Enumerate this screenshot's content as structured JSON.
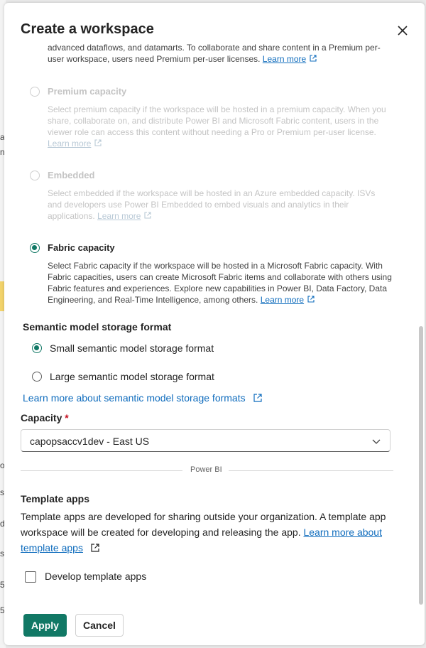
{
  "background": {
    "fragments": [
      "a",
      "n",
      "o",
      "s",
      "d",
      "s",
      "5",
      "5"
    ]
  },
  "dialog": {
    "title": "Create a workspace",
    "close_label": "Close"
  },
  "intro": {
    "line1": "advanced dataflows, and datamarts. To collaborate and share content in a Premium per-",
    "line2": "user workspace, users need Premium per-user licenses. ",
    "link": "Learn more"
  },
  "license_options": [
    {
      "label": "Premium capacity",
      "state": "disabled",
      "lines": [
        "Select premium capacity if the workspace will be hosted in a premium capacity. When you",
        "share, collaborate on, and distribute Power BI and Microsoft Fabric content, users in the",
        "viewer role can access this content without needing a Pro or Premium per-user license."
      ],
      "link": "Learn more"
    },
    {
      "label": "Embedded",
      "state": "disabled",
      "lines": [
        "Select embedded if the workspace will be hosted in an Azure embedded capacity. ISVs",
        "and developers use Power BI Embedded to embed visuals and analytics in their",
        "applications. "
      ],
      "link": "Learn more"
    },
    {
      "label": "Fabric capacity",
      "state": "selected",
      "lines": [
        "Select Fabric capacity if the workspace will be hosted in a Microsoft Fabric capacity. With",
        "Fabric capacities, users can create Microsoft Fabric items and collaborate with others using",
        "Fabric features and experiences. Explore new capabilities in Power BI, Data Factory, Data",
        "Engineering, and Real-Time Intelligence, among others. "
      ],
      "link": "Learn more"
    }
  ],
  "storage_format": {
    "heading": "Semantic model storage format",
    "options": [
      {
        "label": "Small semantic model storage format",
        "selected": true
      },
      {
        "label": "Large semantic model storage format",
        "selected": false
      }
    ],
    "link": "Learn more about semantic model storage formats"
  },
  "capacity": {
    "label": "Capacity",
    "required_mark": "*",
    "value": "capopsaccv1dev - East US"
  },
  "divider_label": "Power BI",
  "template_apps": {
    "heading": "Template apps",
    "line1": "Template apps are developed for sharing outside your organization. A template app",
    "line2": "workspace will be created for developing and releasing the app. ",
    "link_part1": "Learn more about",
    "link_part2": "template apps",
    "checkbox_label": "Develop template apps",
    "checkbox_checked": false
  },
  "buttons": {
    "apply": "Apply",
    "cancel": "Cancel"
  },
  "colors": {
    "accent": "#117865",
    "link": "#0f6cbd"
  }
}
